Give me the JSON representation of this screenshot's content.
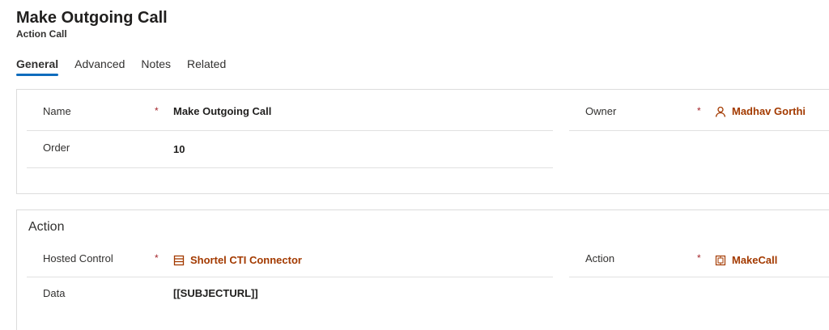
{
  "header": {
    "title": "Make Outgoing Call",
    "entity": "Action Call"
  },
  "tabs": [
    {
      "label": "General",
      "active": true
    },
    {
      "label": "Advanced",
      "active": false
    },
    {
      "label": "Notes",
      "active": false
    },
    {
      "label": "Related",
      "active": false
    }
  ],
  "general": {
    "name": {
      "label": "Name",
      "required": "*",
      "value": "Make Outgoing Call"
    },
    "order": {
      "label": "Order",
      "value": "10"
    },
    "owner": {
      "label": "Owner",
      "required": "*",
      "value": "Madhav Gorthi",
      "icon": "person-icon"
    }
  },
  "action_section": {
    "title": "Action",
    "hosted_control": {
      "label": "Hosted Control",
      "required": "*",
      "value": "Shortel CTI Connector",
      "icon": "hosted-control-icon"
    },
    "action": {
      "label": "Action",
      "required": "*",
      "value": "MakeCall",
      "icon": "action-icon"
    },
    "data": {
      "label": "Data",
      "value": "[[SUBJECTURL]]"
    }
  },
  "colors": {
    "accent": "#0f6cbd",
    "lookup": "#a33a00",
    "required": "#a4262c"
  }
}
